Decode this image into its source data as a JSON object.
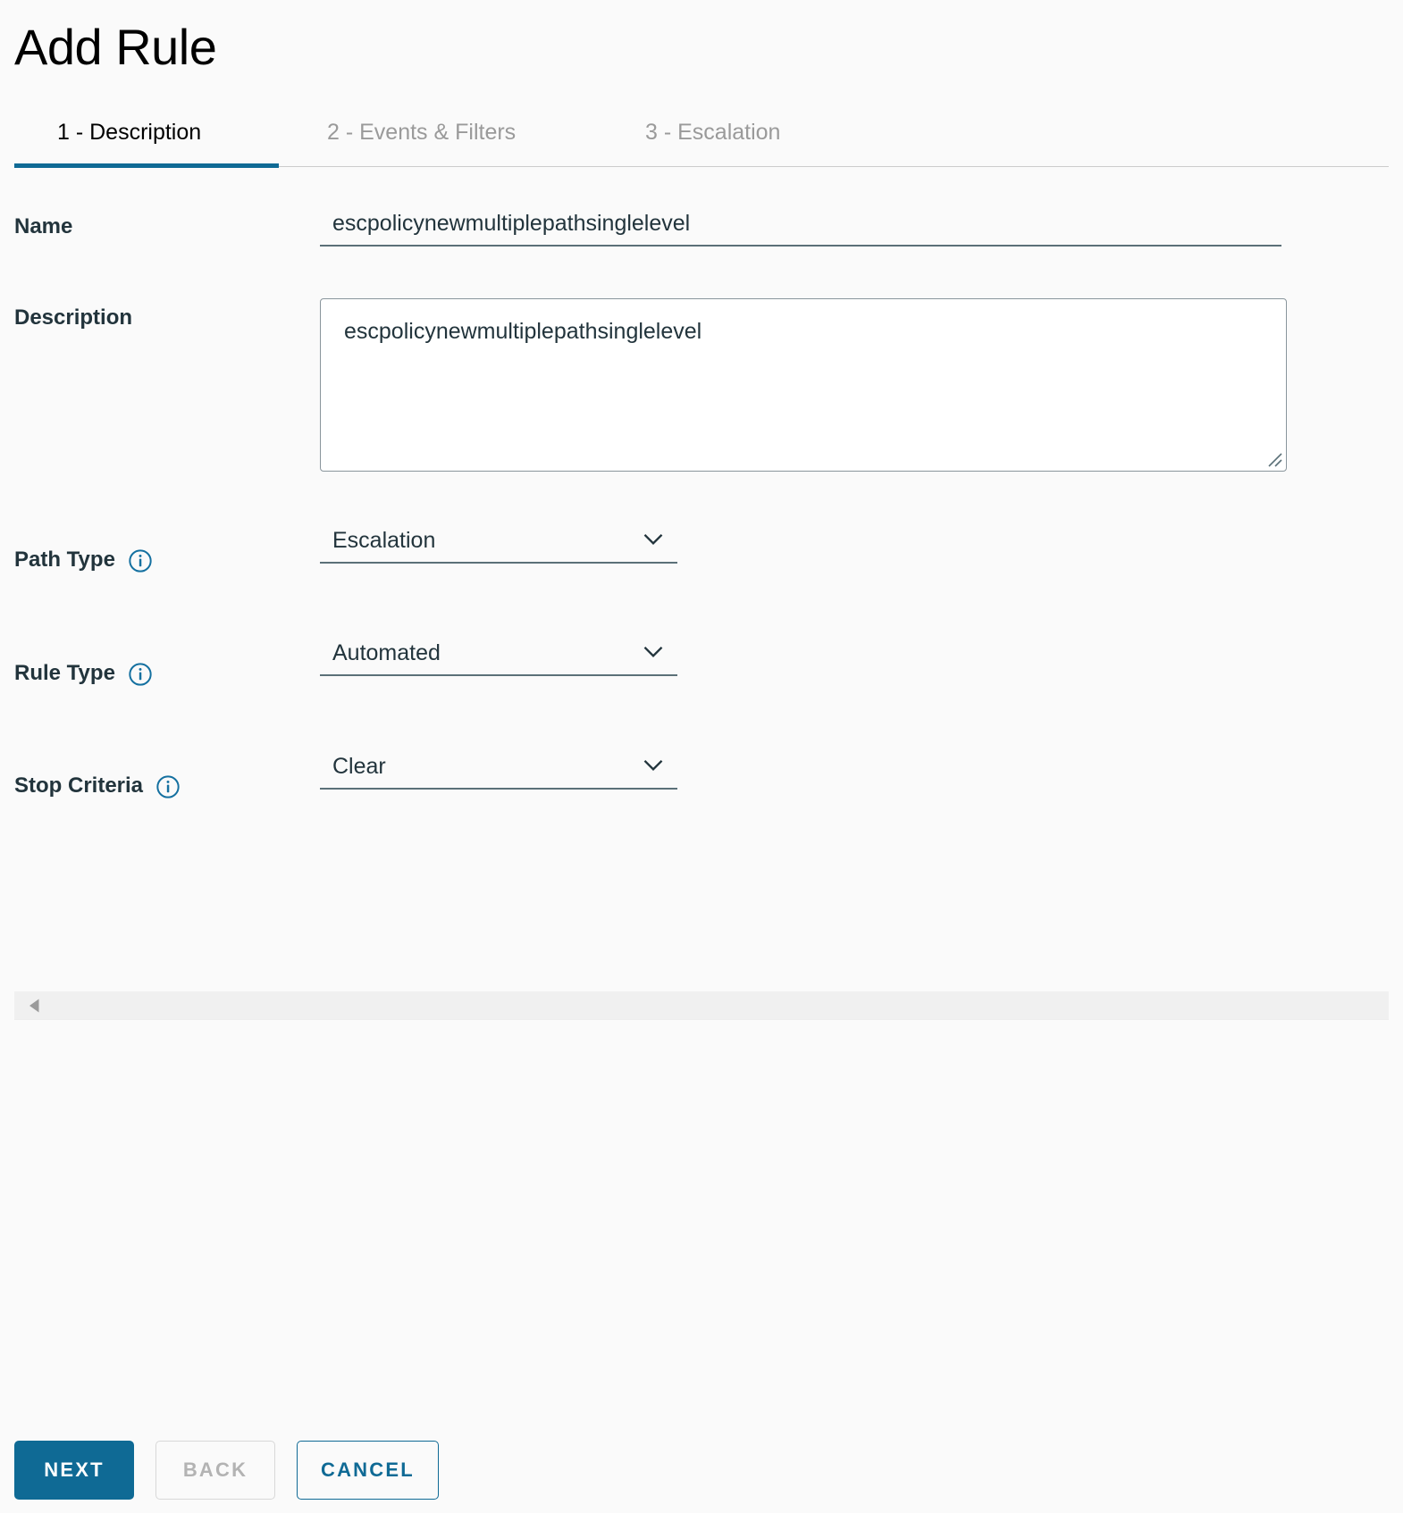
{
  "header": {
    "title": "Add Rule"
  },
  "tabs": {
    "items": [
      {
        "label": "1 - Description",
        "active": true
      },
      {
        "label": "2 - Events & Filters",
        "active": false
      },
      {
        "label": "3 - Escalation",
        "active": false
      }
    ],
    "accent_color": "#0f6a95"
  },
  "form": {
    "name": {
      "label": "Name",
      "value": "escpolicynewmultiplepathsinglelevel",
      "placeholder": ""
    },
    "description": {
      "label": "Description",
      "value": "escpolicynewmultiplepathsinglelevel",
      "placeholder": ""
    },
    "path_type": {
      "label": "Path Type",
      "value": "Escalation",
      "info_icon": "info-circle-icon"
    },
    "rule_type": {
      "label": "Rule Type",
      "value": "Automated",
      "info_icon": "info-circle-icon"
    },
    "stop_criteria": {
      "label": "Stop Criteria",
      "value": "Clear",
      "info_icon": "info-circle-icon"
    }
  },
  "scrollbar": {
    "arrow_icon": "caret-left-icon"
  },
  "footer": {
    "next_label": "NEXT",
    "back_label": "BACK",
    "cancel_label": "CANCEL"
  },
  "colors": {
    "accent": "#0f6a95",
    "text": "#22343c",
    "muted": "#9a9a9a",
    "background": "#fafafa",
    "field_border": "#5b7078"
  }
}
